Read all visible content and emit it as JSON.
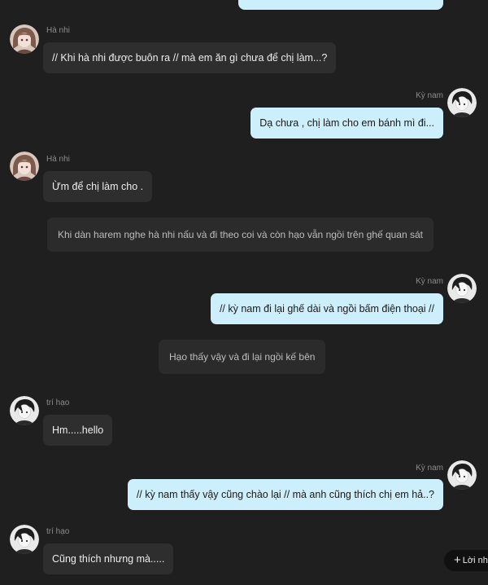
{
  "messages": [
    {
      "sender": "Hà nhi",
      "text": "// Khi hà nhi được buôn ra // mà em ăn gì chưa để chị làm...?"
    },
    {
      "sender": "Kỳ nam",
      "text": "Dạ chưa , chị làm cho em bánh mì đi..."
    },
    {
      "sender": "Hà nhi",
      "text": "Ừm để chị làm cho ."
    },
    {
      "narration": "Khi dàn harem nghe hà nhi nấu và đi theo coi và còn hạo vẫn ngồi trên ghế quan sát"
    },
    {
      "sender": "Kỳ nam",
      "text": "// kỳ nam đi lại ghế dài và ngồi bấm điện thoại //"
    },
    {
      "narration": "Hạo thấy vậy và đi lại ngồi kế bên"
    },
    {
      "sender": "trí hạo",
      "text": "Hm.....hello"
    },
    {
      "sender": "Kỳ nam",
      "text": "// kỳ nam thấy vậy cũng chào lại // mà anh cũng thích chị em hả..?"
    },
    {
      "sender": "trí hạo",
      "text": "Cũng thích nhưng mà....."
    }
  ],
  "reply_button": {
    "label": "Lời nh"
  },
  "colors": {
    "background": "#1f1f1f",
    "left_bubble": "#2e2e2e",
    "right_bubble": "#cdeefb",
    "narration_bubble": "#2b2b2b",
    "name_text": "#8c8c8c"
  },
  "icons": {
    "avatar_hanhi": "girl-avatar-icon",
    "avatar_kynam": "boy-avatar-icon",
    "avatar_trihao": "boy-avatar-icon",
    "reply": "plus-icon"
  }
}
